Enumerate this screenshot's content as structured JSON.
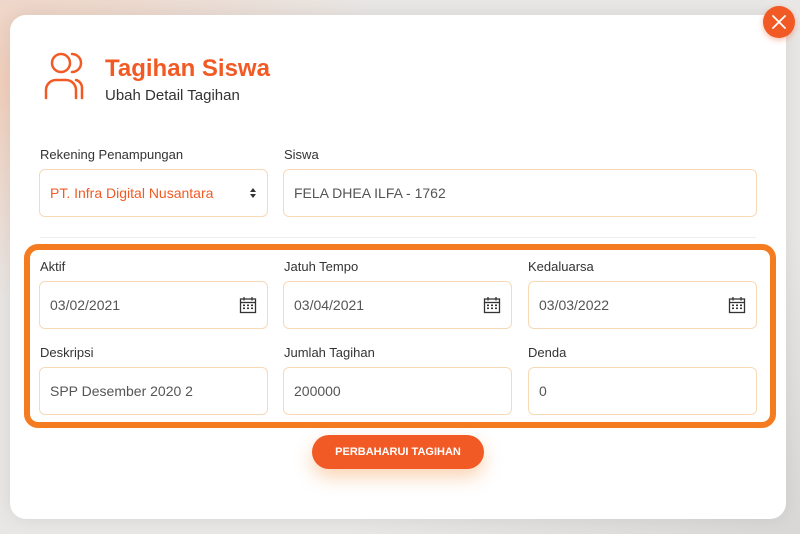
{
  "header": {
    "title": "Tagihan Siswa",
    "subtitle": "Ubah Detail Tagihan",
    "icon": "users-icon"
  },
  "form": {
    "rekening": {
      "label": "Rekening Penampungan",
      "value": "PT. Infra Digital Nusantara"
    },
    "siswa": {
      "label": "Siswa",
      "value": "FELA DHEA ILFA - 1762"
    },
    "aktif": {
      "label": "Aktif",
      "value": "03/02/2021"
    },
    "jatuh_tempo": {
      "label": "Jatuh Tempo",
      "value": "03/04/2021"
    },
    "kedaluarsa": {
      "label": "Kedaluarsa",
      "value": "03/03/2022"
    },
    "deskripsi": {
      "label": "Deskripsi",
      "value": "SPP Desember 2020 2"
    },
    "jumlah_tagihan": {
      "label": "Jumlah Tagihan",
      "value": "200000"
    },
    "denda": {
      "label": "Denda",
      "value": "0"
    }
  },
  "actions": {
    "submit_label": "PERBAHARUI TAGIHAN",
    "close_icon": "close-icon"
  },
  "colors": {
    "accent": "#f15a24",
    "highlight": "#f47b20",
    "field_border": "#f7d9b8"
  }
}
